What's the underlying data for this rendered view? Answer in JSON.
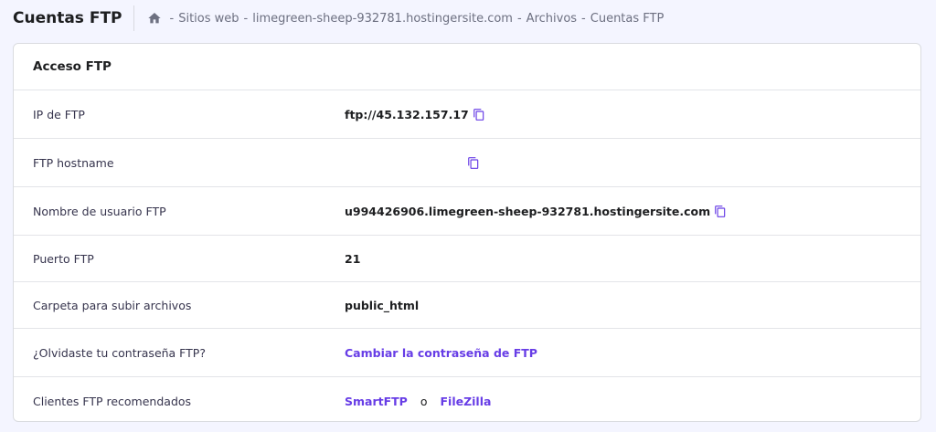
{
  "header": {
    "title": "Cuentas FTP",
    "breadcrumb": {
      "sep": "-",
      "items": [
        "Sitios web",
        "limegreen-sheep-932781.hostingersite.com",
        "Archivos",
        "Cuentas FTP"
      ]
    }
  },
  "card": {
    "title": "Acceso FTP",
    "rows": {
      "ip": {
        "label": "IP de FTP",
        "value": "ftp://45.132.157.17"
      },
      "hostname": {
        "label": "FTP hostname",
        "value": ""
      },
      "username": {
        "label": "Nombre de usuario FTP",
        "value": "u994426906.limegreen-sheep-932781.hostingersite.com"
      },
      "port": {
        "label": "Puerto FTP",
        "value": "21"
      },
      "folder": {
        "label": "Carpeta para subir archivos",
        "value": "public_html"
      },
      "password": {
        "label": "¿Olvidaste tu contraseña FTP?",
        "link": "Cambiar la contraseña de FTP"
      },
      "clients": {
        "label": "Clientes FTP recomendados",
        "link1": "SmartFTP",
        "or": "o",
        "link2": "FileZilla"
      }
    }
  },
  "icons": {
    "home": "home-icon",
    "copy": "copy-icon"
  },
  "colors": {
    "accent": "#673de6",
    "background": "#f4f5ff",
    "text": "#1d1e20"
  }
}
